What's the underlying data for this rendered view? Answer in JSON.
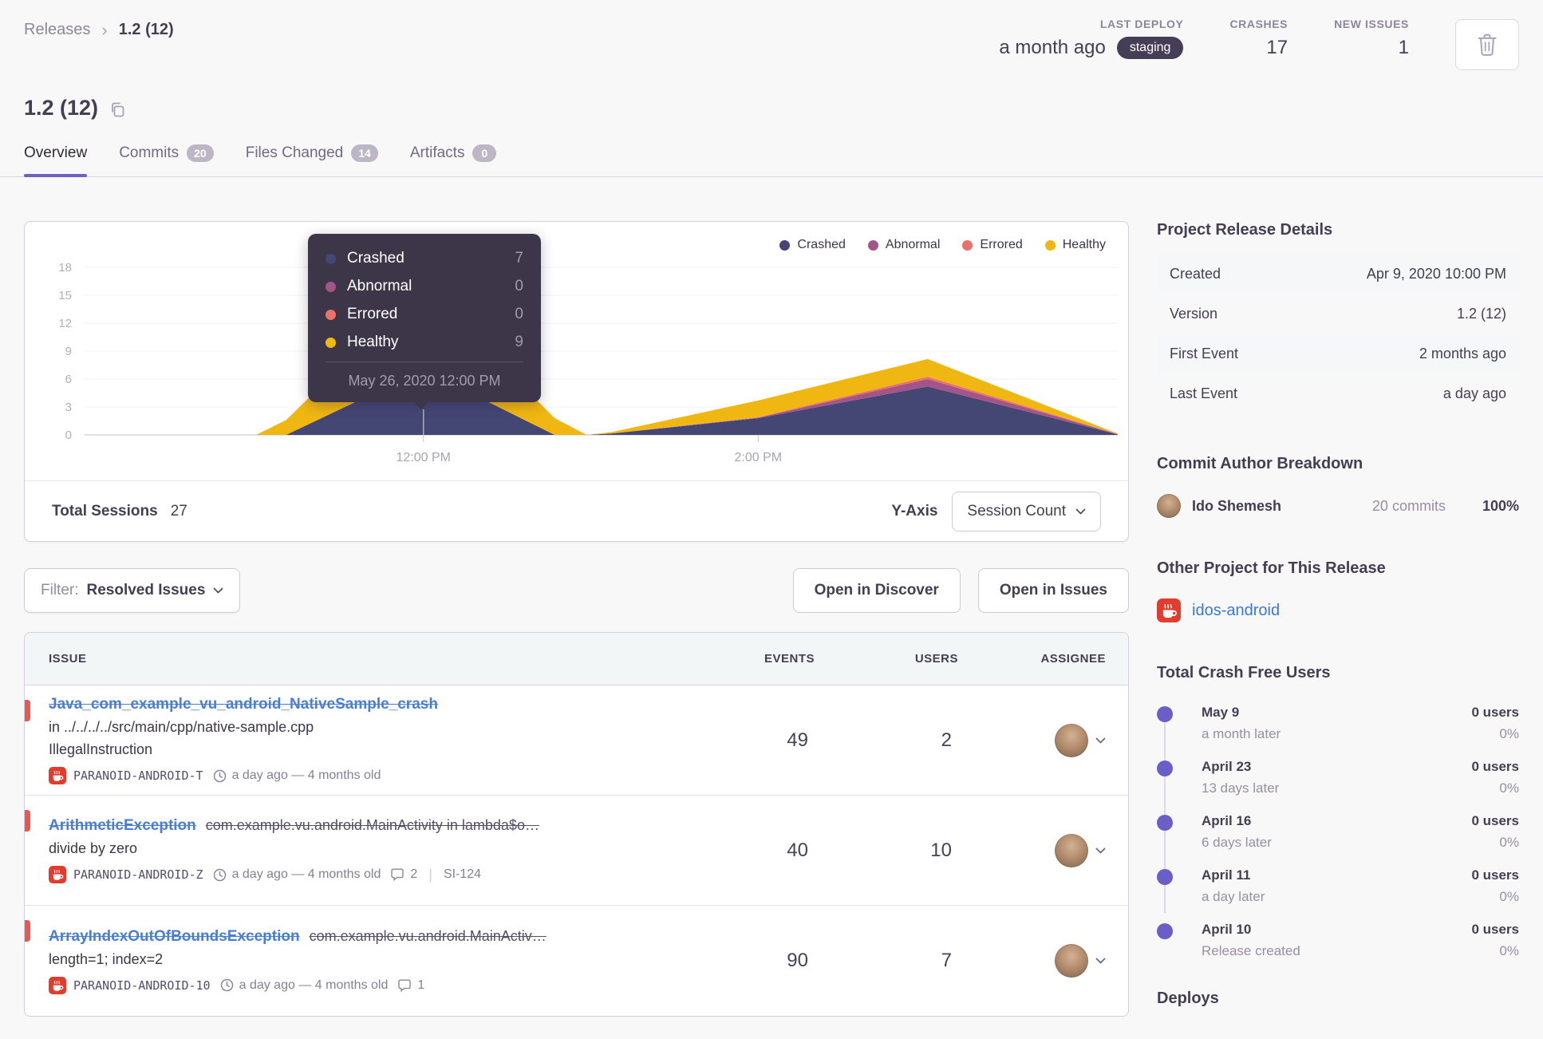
{
  "breadcrumb": {
    "parent": "Releases",
    "current": "1.2 (12)"
  },
  "header": {
    "last_deploy_label": "LAST DEPLOY",
    "last_deploy_value": "a month ago",
    "last_deploy_badge": "staging",
    "crashes_label": "CRASHES",
    "crashes_value": "17",
    "new_issues_label": "NEW ISSUES",
    "new_issues_value": "1"
  },
  "title": "1.2 (12)",
  "tabs": {
    "overview": "Overview",
    "commits": "Commits",
    "commits_count": "20",
    "files_changed": "Files Changed",
    "files_changed_count": "14",
    "artifacts": "Artifacts",
    "artifacts_count": "0"
  },
  "chart": {
    "legend": [
      {
        "label": "Crashed",
        "color": "#444674"
      },
      {
        "label": "Abnormal",
        "color": "#a35488"
      },
      {
        "label": "Errored",
        "color": "#e9716b"
      },
      {
        "label": "Healthy",
        "color": "#f0b712"
      }
    ],
    "tooltip": {
      "rows": [
        {
          "label": "Crashed",
          "value": "7"
        },
        {
          "label": "Abnormal",
          "value": "0"
        },
        {
          "label": "Errored",
          "value": "0"
        },
        {
          "label": "Healthy",
          "value": "9"
        }
      ],
      "footer": "May 26, 2020 12:00 PM"
    },
    "total_label": "Total Sessions",
    "total_value": "27",
    "yaxis_label": "Y-Axis",
    "yaxis_value": "Session Count"
  },
  "chart_data": {
    "type": "area",
    "stacked": true,
    "title": "Session count by status over time",
    "ylim": [
      0,
      18
    ],
    "y_ticks": [
      0,
      3,
      6,
      9,
      12,
      15,
      18
    ],
    "x_ticks": [
      {
        "label": "12:00 PM",
        "f": 0.328
      },
      {
        "label": "2:00 PM",
        "f": 0.652
      }
    ],
    "series_order": [
      "Crashed",
      "Abnormal",
      "Errored",
      "Healthy"
    ],
    "points": [
      {
        "f": 0.166,
        "Crashed": 0,
        "Abnormal": 0,
        "Errored": 0,
        "Healthy": 0
      },
      {
        "f": 0.195,
        "Crashed": 0,
        "Abnormal": 0,
        "Errored": 0,
        "Healthy": 1.6
      },
      {
        "f": 0.328,
        "Crashed": 7,
        "Abnormal": 0,
        "Errored": 0,
        "Healthy": 9
      },
      {
        "f": 0.455,
        "Crashed": 0,
        "Abnormal": 0,
        "Errored": 0,
        "Healthy": 1.8
      },
      {
        "f": 0.486,
        "Crashed": 0,
        "Abnormal": 0,
        "Errored": 0,
        "Healthy": 0
      },
      {
        "f": 0.51,
        "Crashed": 0.15,
        "Abnormal": 0,
        "Errored": 0,
        "Healthy": 0.15
      },
      {
        "f": 0.652,
        "Crashed": 1.8,
        "Abnormal": 0.05,
        "Errored": 0.05,
        "Healthy": 1.8
      },
      {
        "f": 0.816,
        "Crashed": 5.2,
        "Abnormal": 0.8,
        "Errored": 0.25,
        "Healthy": 1.9
      },
      {
        "f": 1.0,
        "Crashed": 0.05,
        "Abnormal": 0.02,
        "Errored": 0.02,
        "Healthy": 0.05
      }
    ]
  },
  "issues": {
    "filter_label": "Filter:",
    "filter_value": "Resolved Issues",
    "open_in_discover": "Open in Discover",
    "open_in_issues": "Open in Issues",
    "col_issue": "ISSUE",
    "col_events": "EVENTS",
    "col_users": "USERS",
    "col_assignee": "ASSIGNEE",
    "rows": [
      {
        "title": "Java_com_example_vu_android_NativeSample_crash",
        "culprit": "",
        "line2": "in ../../../../src/main/cpp/native-sample.cpp",
        "line3": "IllegalInstruction",
        "project": "PARANOID-ANDROID-T",
        "age": "a day ago — 4 months old",
        "events": "49",
        "users": "2"
      },
      {
        "title": "ArithmeticException",
        "culprit": "com.example.vu.android.MainActivity in lambda$o…",
        "line2": "divide by zero",
        "project": "PARANOID-ANDROID-Z",
        "age": "a day ago — 4 months old",
        "comments": "2",
        "ref": "SI-124",
        "events": "40",
        "users": "10"
      },
      {
        "title": "ArrayIndexOutOfBoundsException",
        "culprit": "com.example.vu.android.MainActiv…",
        "line2": "length=1; index=2",
        "project": "PARANOID-ANDROID-10",
        "age": "a day ago — 4 months old",
        "comments": "1",
        "events": "90",
        "users": "7"
      }
    ]
  },
  "sidebar": {
    "details_heading": "Project Release Details",
    "details": [
      {
        "key": "Created",
        "value": "Apr 9, 2020 10:00 PM"
      },
      {
        "key": "Version",
        "value": "1.2 (12)"
      },
      {
        "key": "First Event",
        "value": "2 months ago"
      },
      {
        "key": "Last Event",
        "value": "a day ago"
      }
    ],
    "authors_heading": "Commit Author Breakdown",
    "author_name": "Ido Shemesh",
    "author_commits": "20 commits",
    "author_percent": "100%",
    "other_heading": "Other Project for This Release",
    "other_link": "idos-android",
    "crashfree_heading": "Total Crash Free Users",
    "crashfree": [
      {
        "date": "May 9",
        "sub": "a month later",
        "users": "0 users",
        "pct": "0%"
      },
      {
        "date": "April 23",
        "sub": "13 days later",
        "users": "0 users",
        "pct": "0%"
      },
      {
        "date": "April 16",
        "sub": "6 days later",
        "users": "0 users",
        "pct": "0%"
      },
      {
        "date": "April 11",
        "sub": "a day later",
        "users": "0 users",
        "pct": "0%"
      },
      {
        "date": "April 10",
        "sub": "Release created",
        "users": "0 users",
        "pct": "0%"
      }
    ],
    "deploys_heading": "Deploys"
  }
}
